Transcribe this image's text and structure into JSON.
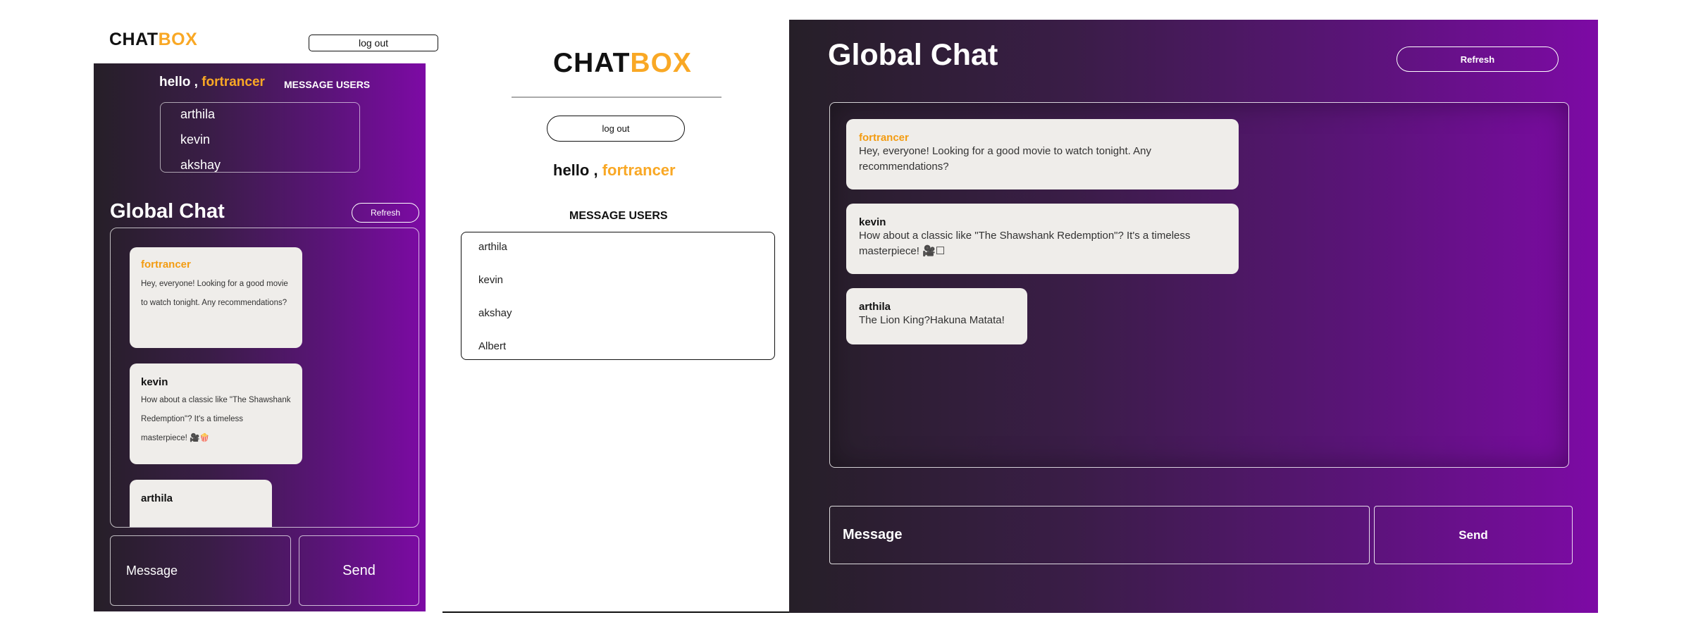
{
  "brand": {
    "part1": "CHAT",
    "part2": "BOX"
  },
  "auth": {
    "logout_label": "log out"
  },
  "greeting": {
    "hello": "hello ,",
    "username": "fortrancer"
  },
  "users": {
    "heading": "MESSAGE USERS",
    "list": [
      "arthila",
      "kevin",
      "akshay",
      "Albert"
    ]
  },
  "chat": {
    "title": "Global Chat",
    "refresh_label": "Refresh",
    "input_placeholder": "Message",
    "send_label": "Send",
    "messages": [
      {
        "sender": "fortrancer",
        "text": "Hey, everyone! Looking for a good movie to watch tonight. Any recommendations?"
      },
      {
        "sender": "kevin",
        "text": "How about a classic like \"The Shawshank Redemption\"? It's a timeless masterpiece! 🎥🍿"
      },
      {
        "sender": "arthila",
        "text": "The Lion King?Hakuna Matata!"
      }
    ],
    "kevin_text_desktop": "How about a classic like \"The Shawshank Redemption\"? It's a timeless masterpiece! 🎥☐"
  },
  "colors": {
    "accent": "#f9a825",
    "grad_start": "#261f28",
    "grad_end": "#7d0aa5",
    "bubble": "#efedea"
  }
}
